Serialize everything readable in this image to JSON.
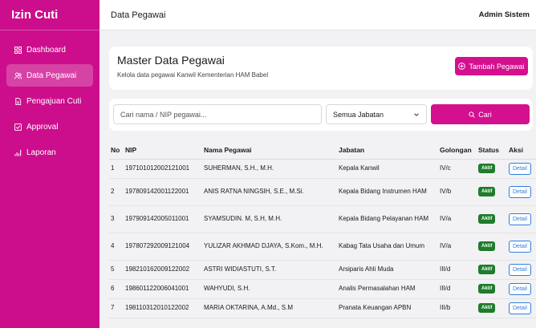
{
  "app": {
    "title": "Izin Cuti"
  },
  "sidebar": {
    "items": [
      {
        "label": "Dashboard",
        "icon": "grid-icon",
        "active": false
      },
      {
        "label": "Data Pegawai",
        "icon": "users-icon",
        "active": true
      },
      {
        "label": "Pengajuan Cuti",
        "icon": "document-icon",
        "active": false
      },
      {
        "label": "Approval",
        "icon": "check-square-icon",
        "active": false
      },
      {
        "label": "Laporan",
        "icon": "bar-chart-icon",
        "active": false
      }
    ]
  },
  "topbar": {
    "title": "Data Pegawai",
    "user": "Admin Sistem"
  },
  "header": {
    "title": "Master Data Pegawai",
    "subtitle": "Kelola data pegawai Kanwil Kementerian HAM Babel",
    "add_button": "Tambah Pegawai"
  },
  "filters": {
    "search_placeholder": "Cari nama / NIP pegawai...",
    "jabatan_selected": "Semua Jabatan",
    "search_button": "Cari"
  },
  "colors": {
    "primary": "#cc0e8c",
    "badge": "#1e7c2c",
    "detail": "#2f7ee0"
  },
  "table": {
    "headers": {
      "no": "No",
      "nip": "NIP",
      "nama": "Nama Pegawai",
      "jabatan": "Jabatan",
      "golongan": "Golongan",
      "status": "Status",
      "aksi": "Aksi"
    },
    "rows": [
      {
        "no": "1",
        "nip": "197101012002121001",
        "nama": "SUHERMAN, S.H., M.H.",
        "jabatan": "Kepala Kanwil",
        "golongan": "IV/c",
        "status": "Aktif",
        "aksi": "Detail"
      },
      {
        "no": "2",
        "nip": "197809142001122001",
        "nama": "ANIS RATNA NINGSIH, S.E., M.Si.",
        "jabatan": "Kepala Bidang Instrumen HAM",
        "golongan": "IV/b",
        "status": "Aktif",
        "aksi": "Detail"
      },
      {
        "no": "3",
        "nip": "197909142005011001",
        "nama": "SYAMSUDIN. M, S.H, M.H.",
        "jabatan": "Kepala Bidang Pelayanan HAM",
        "golongan": "IV/a",
        "status": "Aktif",
        "aksi": "Detail"
      },
      {
        "no": "4",
        "nip": "197807292009121004",
        "nama": "YULIZAR AKHMAD DJAYA, S.Kom., M.H.",
        "jabatan": "Kabag Tata Usaha dan Umum",
        "golongan": "IV/a",
        "status": "Aktif",
        "aksi": "Detail"
      },
      {
        "no": "5",
        "nip": "198210162009122002",
        "nama": "ASTRI WIDIASTUTI, S.T.",
        "jabatan": "Arsiparis Ahli Muda",
        "golongan": "III/d",
        "status": "Aktif",
        "aksi": "Detail"
      },
      {
        "no": "6",
        "nip": "198601122006041001",
        "nama": "WAHYUDI, S.H.",
        "jabatan": "Analis Permasalahan HAM",
        "golongan": "III/d",
        "status": "Aktif",
        "aksi": "Detail"
      },
      {
        "no": "7",
        "nip": "198110312010122002",
        "nama": "MARIA OKTARINA, A.Md., S.M",
        "jabatan": "Pranata Keuangan APBN",
        "golongan": "III/b",
        "status": "Aktif",
        "aksi": "Detail"
      }
    ]
  }
}
